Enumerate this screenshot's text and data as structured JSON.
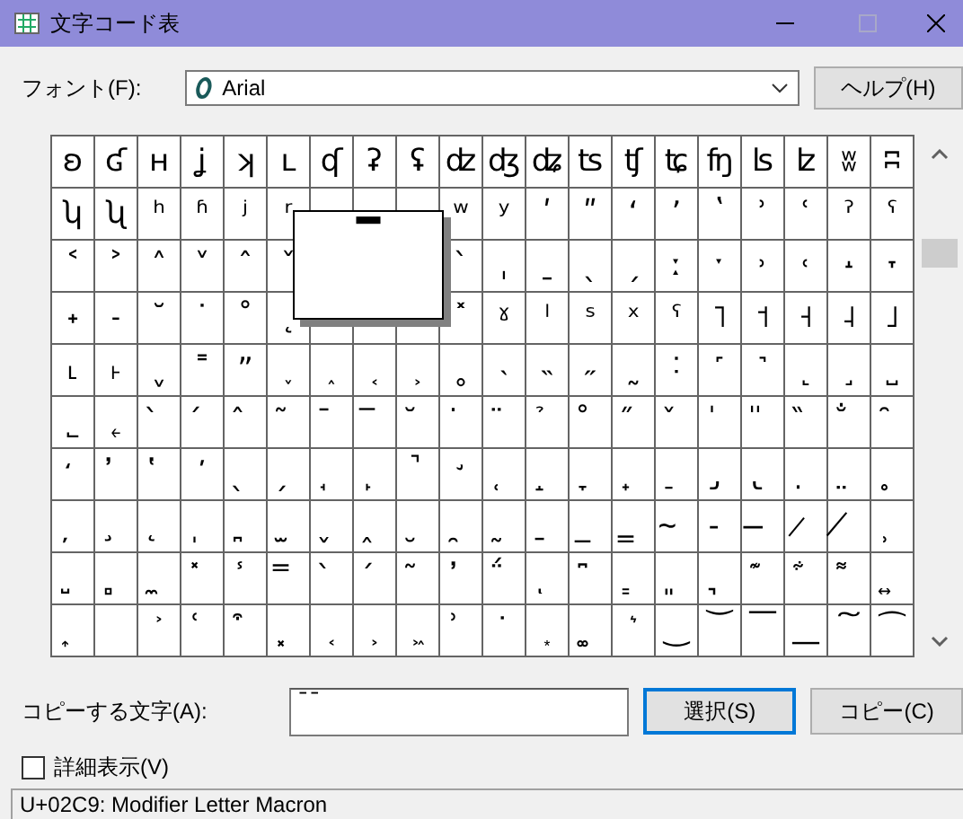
{
  "window": {
    "title": "文字コード表"
  },
  "font": {
    "label": "フォント(F):",
    "value": "Arial"
  },
  "help_button": "ヘルプ(H)",
  "grid": {
    "rows": [
      [
        "ʚ",
        "ʛ",
        "ʜ",
        "ʝ",
        "ʞ",
        "ʟ",
        "ʠ",
        "ʡ",
        "ʢ",
        "ʣ",
        "ʤ",
        "ʥ",
        "ʦ",
        "ʧ",
        "ʨ",
        "ʩ",
        "ʪ",
        "ʫ",
        "ʬ",
        "ʭ"
      ],
      [
        "ʮ",
        "ʯ",
        "ʰ",
        "ʱ",
        "ʲ",
        "ʳ",
        null,
        null,
        null,
        "ʷ",
        "ʸ",
        "ʹ",
        "ʺ",
        "ʻ",
        "ʼ",
        "ʽ",
        "ʾ",
        "ʿ",
        "ˀ",
        "ˁ"
      ],
      [
        "˂",
        "˃",
        "˄",
        "˅",
        "ˆ",
        "ˇ",
        null,
        null,
        null,
        "ˋ",
        "ˌ",
        "ˍ",
        "ˎ",
        "ˏ",
        "ː",
        "ˑ",
        "˒",
        "˓",
        "˔",
        "˕"
      ],
      [
        "˖",
        "˗",
        "˘",
        "˙",
        "˚",
        "˛",
        null,
        null,
        null,
        "˟",
        "ˠ",
        "ˡ",
        "ˢ",
        "ˣ",
        "ˤ",
        "˥",
        "˦",
        "˧",
        "˨",
        "˩"
      ],
      [
        "˪",
        "˫",
        "ˬ",
        "˭",
        "ˮ",
        "˯",
        "˰",
        "˱",
        "˲",
        "˳",
        "˴",
        "˵",
        "˶",
        "˷",
        "˸",
        "˹",
        "˺",
        "˻",
        "˼",
        "˽"
      ],
      [
        "˾",
        "˿",
        "̀",
        "́",
        "̂",
        "̃",
        "̄",
        "̅",
        "̆",
        "̇",
        "̈",
        "̉",
        "̊",
        "̋",
        "̌",
        "̍",
        "̎",
        "̏",
        "̐",
        "̑"
      ],
      [
        "̒",
        "̓",
        "̔",
        "̕",
        "̖",
        "̗",
        "̘",
        "̙",
        "̚",
        "̛",
        "̜",
        "̝",
        "̞",
        "̟",
        "̠",
        "̡",
        "̢",
        "̣",
        "̤",
        "̥"
      ],
      [
        "̦",
        "̧",
        "̨",
        "̩",
        "̪",
        "̫",
        "̬",
        "̭",
        "̮",
        "̯",
        "̰",
        "̱",
        "̲",
        "̳",
        "̴",
        "̵",
        "̶",
        "̷",
        "̸",
        "̹"
      ],
      [
        "̺",
        "̻",
        "̼",
        "̽",
        "̾",
        "̿",
        "̀",
        "́",
        "͂",
        "̓",
        "̈́",
        "ͅ",
        "͆",
        "͇",
        "͈",
        "͉",
        "͊",
        "͋",
        "͌",
        "͍"
      ],
      [
        "͎",
        null,
        "͐",
        "͑",
        "͒",
        "͓",
        "͔",
        "͕",
        "͖",
        "͗",
        "͘",
        "͙",
        "͚",
        "͛",
        "͜",
        "͝",
        "͞",
        "͟",
        "͠",
        "͡"
      ]
    ]
  },
  "popup": {
    "char": "ˉ"
  },
  "copy": {
    "label": "コピーする文字(A):",
    "value": "ˉˉ"
  },
  "buttons": [
    {
      "label": "選択(S)",
      "default": true
    },
    {
      "label": "コピー(C)",
      "default": false
    }
  ],
  "advanced": {
    "label": "詳細表示(V)",
    "checked": false
  },
  "status_bar": "U+02C9: Modifier Letter Macron"
}
